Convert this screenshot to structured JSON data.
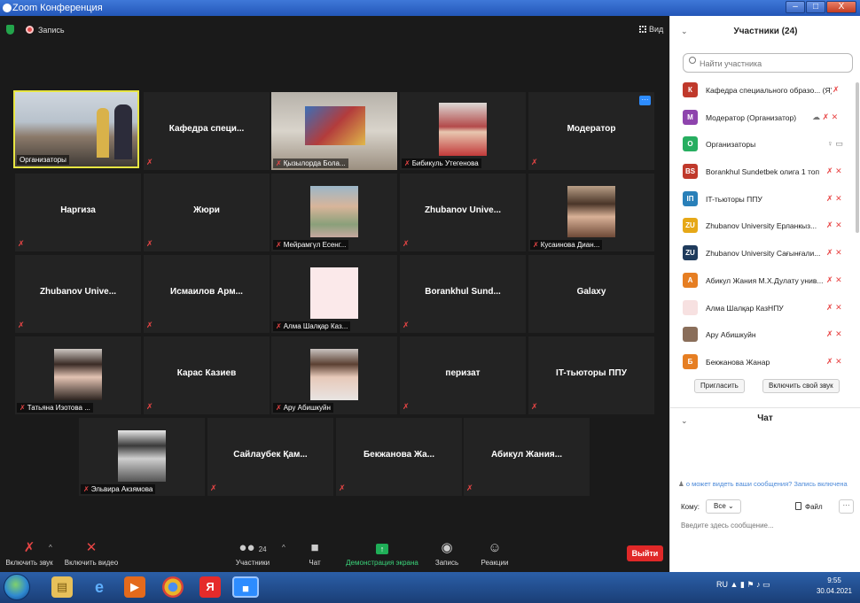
{
  "window": {
    "title": "Zoom Конференция",
    "btn_min": "–",
    "btn_max": "□",
    "btn_close": "X"
  },
  "topbar": {
    "recording_label": "Запись",
    "view_label": "Вид"
  },
  "tiles": [
    {
      "name": "Организаторы",
      "center": ""
    },
    {
      "name": "",
      "center": "Кафедра специ..."
    },
    {
      "name": "Қызылорда Бола...",
      "center": ""
    },
    {
      "name": "Бибикуль Утегенова",
      "center": ""
    },
    {
      "name": "",
      "center": "Модератор",
      "more": "···"
    },
    {
      "name": "",
      "center": "Наргиза"
    },
    {
      "name": "",
      "center": "Жюри"
    },
    {
      "name": "Мейрамгүл Есенг...",
      "center": ""
    },
    {
      "name": "",
      "center": "Zhubanov Unive..."
    },
    {
      "name": "Кусаинова Диан...",
      "center": ""
    },
    {
      "name": "",
      "center": "Zhubanov Unive..."
    },
    {
      "name": "",
      "center": "Исмаилов Арм..."
    },
    {
      "name": "Алма Шалқар Каз...",
      "center": ""
    },
    {
      "name": "",
      "center": "Borankhul Sund..."
    },
    {
      "name": "",
      "center": "Galaxy"
    },
    {
      "name": "Татьяна Изотова ...",
      "center": ""
    },
    {
      "name": "",
      "center": "Карас Казиев"
    },
    {
      "name": "Ару Абишкуйн",
      "center": ""
    },
    {
      "name": "",
      "center": "перизат"
    },
    {
      "name": "",
      "center": "IT-тьюторы ППУ"
    },
    {
      "name": "Эльвира Акзямова",
      "center": ""
    },
    {
      "name": "",
      "center": "Сайлаубек Қам..."
    },
    {
      "name": "",
      "center": "Бекжанова Жа..."
    },
    {
      "name": "",
      "center": "Абикул Жания..."
    }
  ],
  "toolbar": {
    "unmute": "Включить звук",
    "start_video": "Включить видео",
    "participants": "Участники",
    "participants_count": "24",
    "chat": "Чат",
    "share": "Демонстрация экрана",
    "record": "Запись",
    "reactions": "Реакции",
    "leave": "Выйти"
  },
  "participants_panel": {
    "title": "Участники (24)",
    "search_placeholder": "Найти участника",
    "items": [
      {
        "initials": "К",
        "color": "#c0392b",
        "name": "Кафедра специального образо... (Я)"
      },
      {
        "initials": "М",
        "color": "#8e44ad",
        "name": "Модератор (Организатор)"
      },
      {
        "initials": "О",
        "color": "#27ae60",
        "name": "Организаторы"
      },
      {
        "initials": "BS",
        "color": "#c0392b",
        "name": "Borankhul Sundetbek олига 1 топ"
      },
      {
        "initials": "IП",
        "color": "#2980b9",
        "name": "IT-тьюторы ППУ"
      },
      {
        "initials": "ZU",
        "color": "#e6a817",
        "name": "Zhubanov University Ерланкыз..."
      },
      {
        "initials": "ZU",
        "color": "#1f3b5c",
        "name": "Zhubanov University Сағынғали..."
      },
      {
        "initials": "А",
        "color": "#e67e22",
        "name": "Абикул Жания М.Х.Дулату унив..."
      },
      {
        "initials": "",
        "color": "#f7e1e1",
        "name": "Алма Шалқар КазНПУ"
      },
      {
        "initials": "",
        "color": "#8a6e5a",
        "name": "Ару Абишкуйн"
      },
      {
        "initials": "Б",
        "color": "#e67e22",
        "name": "Бекжанова Жанар"
      }
    ],
    "invite": "Пригласить",
    "unmute_me": "Включить свой звук"
  },
  "chat_panel": {
    "title": "Чат",
    "notice": "о может видеть ваши сообщения? Запись включена",
    "to_label": "Кому:",
    "to_value": "Все",
    "file": "Файл",
    "more": "···",
    "placeholder": "Введите здесь сообщение..."
  },
  "taskbar": {
    "lang": "RU",
    "time": "9:55",
    "date": "30.04.2021"
  }
}
